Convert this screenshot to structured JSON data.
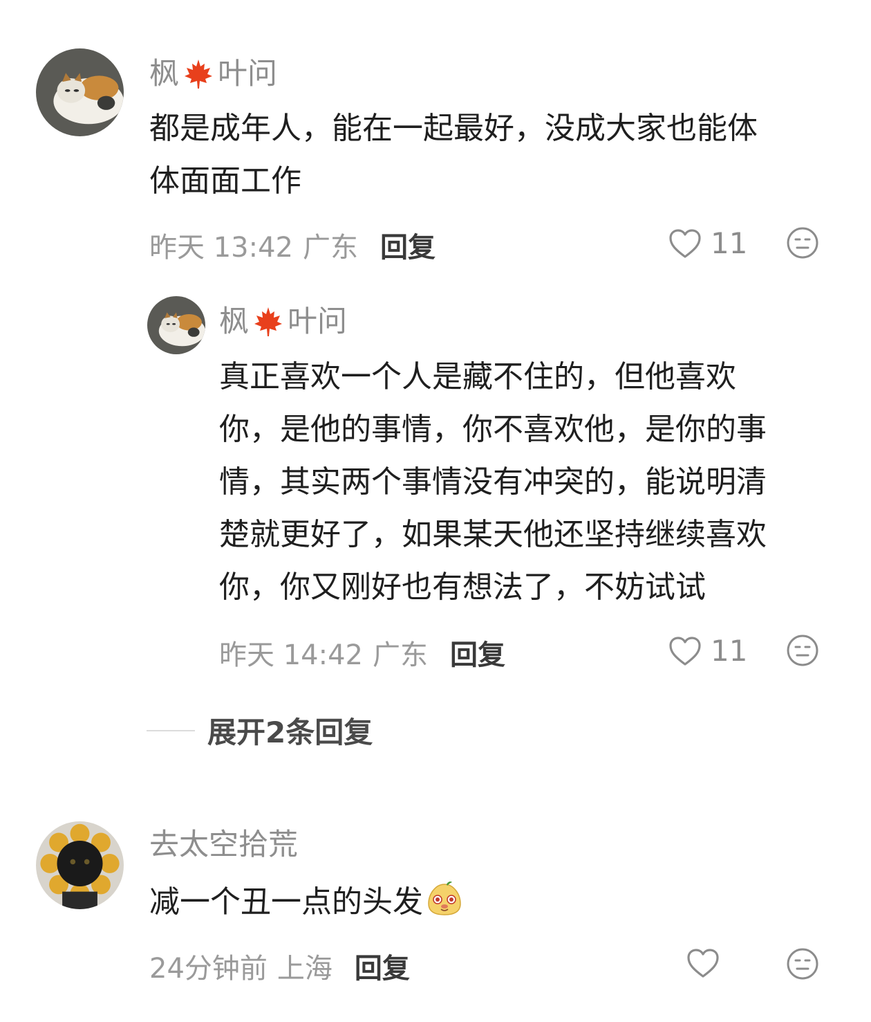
{
  "comments": [
    {
      "username": "枫",
      "username_suffix": "叶问",
      "text_lines": [
        "都是成年人，能在一起最好，没成大家也能体",
        "体面面工作"
      ],
      "time": "昨天 13:42",
      "location": "广东",
      "reply_label": "回复",
      "like_count": "11"
    },
    {
      "username": "枫",
      "username_suffix": "叶问",
      "text_lines": [
        "真正喜欢一个人是藏不住的，但他喜欢",
        "你，是他的事情，你不喜欢他，是你的事",
        "情，其实两个事情没有冲突的，能说明清",
        "楚就更好了，如果某天他还坚持继续喜欢",
        "你，你又刚好也有想法了，不妨试试"
      ],
      "time": "昨天 14:42",
      "location": "广东",
      "reply_label": "回复",
      "like_count": "11"
    },
    {
      "username": "去太空拾荒",
      "text": "减一个丑一点的头发",
      "time": "24分钟前",
      "location": "上海",
      "reply_label": "回复",
      "like_count": ""
    }
  ],
  "expand_replies": "展开2条回复",
  "icons": {
    "like": "heart-outline-icon",
    "dislike": "meh-face-icon",
    "maple": "maple-leaf-icon",
    "emoji": "cute-face-emoji-icon"
  },
  "colors": {
    "username": "#8e8e8e",
    "meta": "#9a9a9a",
    "maple": "#e8401c"
  }
}
